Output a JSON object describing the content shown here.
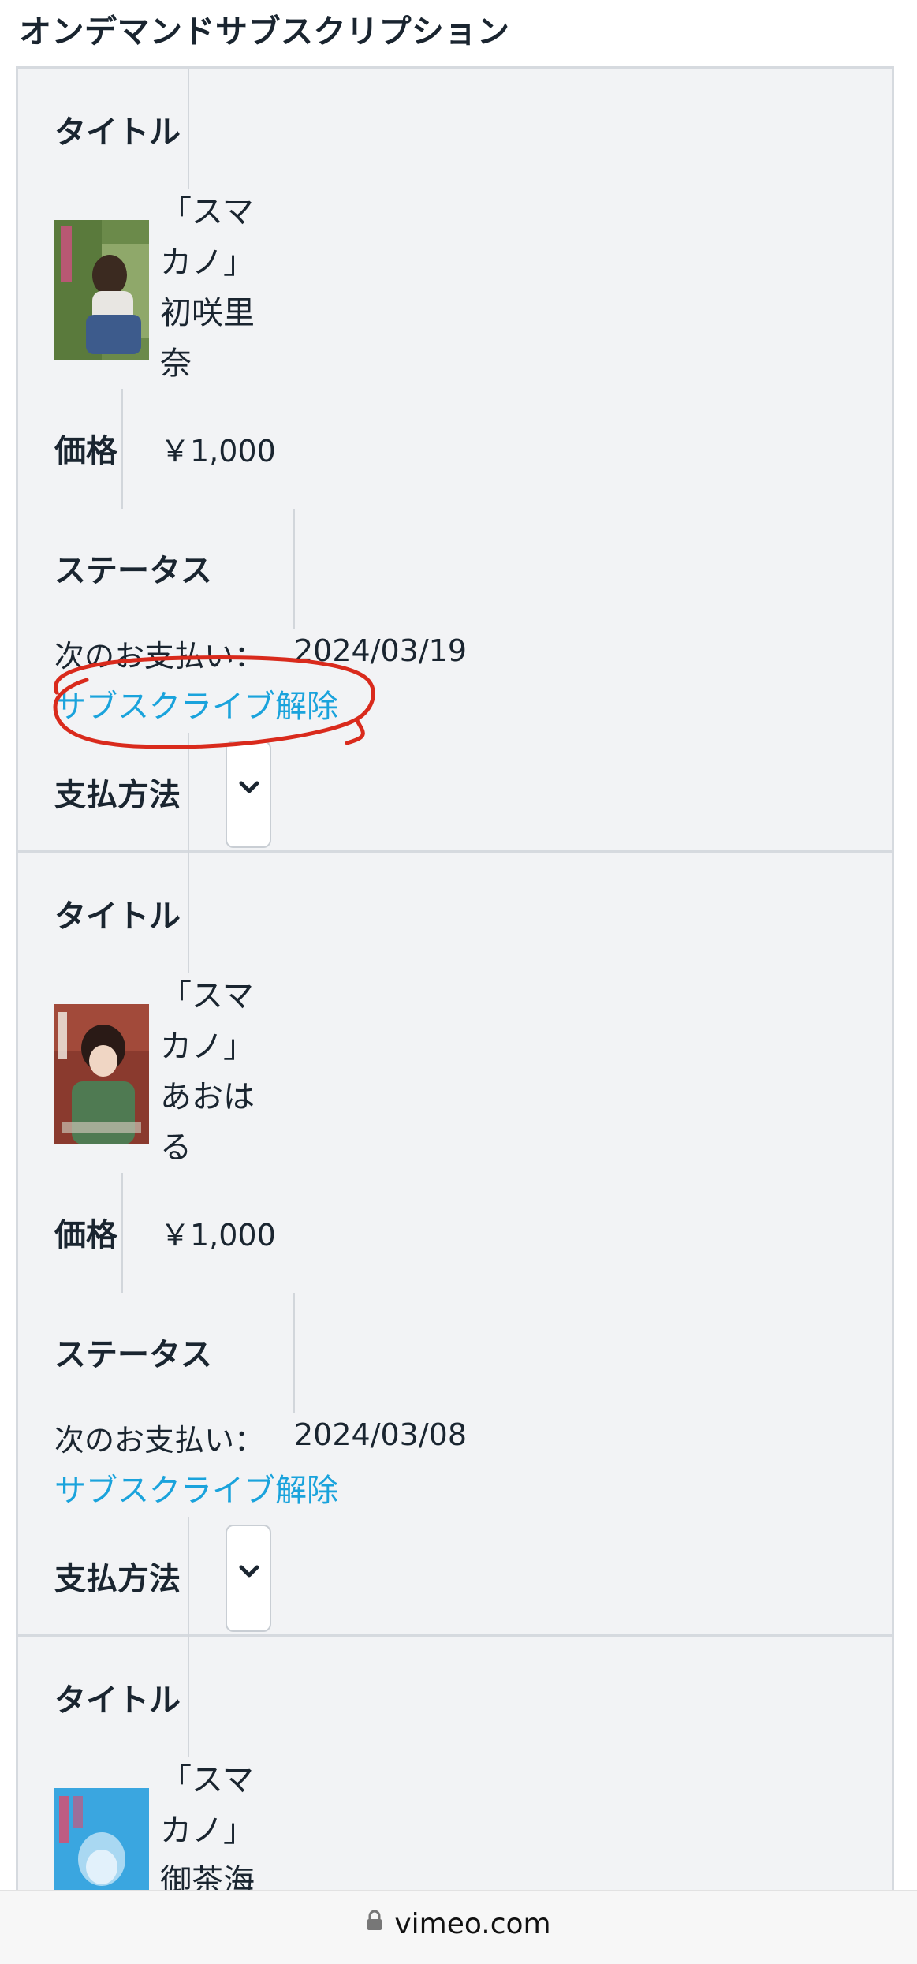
{
  "page": {
    "heading": "オンデマンドサブスクリプション"
  },
  "labels": {
    "title": "タイトル",
    "price": "価格",
    "status": "ステータス",
    "payment_method": "支払方法",
    "next_payment": "次のお支払い："
  },
  "subscriptions": [
    {
      "title": "「スマカノ」初咲里奈",
      "title_lines": "「スマ\nカノ」\n初咲里\n奈",
      "price": "￥1,000",
      "next_payment_date": "2024/03/19",
      "unsubscribe_label": "サブスクライブ解除",
      "thumb_icon": "poster-image",
      "thumb_colors": [
        "#6b8a4a",
        "#d9d6cf",
        "#3d5b8c"
      ]
    },
    {
      "title": "「スマカノ」あおはる",
      "title_lines": "「スマ\nカノ」\nあおは\nる",
      "price": "￥1,000",
      "next_payment_date": "2024/03/08",
      "unsubscribe_label": "サブスクライブ解除",
      "thumb_icon": "poster-image",
      "thumb_colors": [
        "#8a3a2e",
        "#4f7a52",
        "#c9c2b4"
      ]
    },
    {
      "title": "「スマカノ」御茶海",
      "title_lines": "「スマ\nカノ」\n御茶海",
      "thumb_icon": "poster-image",
      "thumb_colors": [
        "#3aa6e0",
        "#a9d8f2",
        "#e2f1fb"
      ]
    }
  ],
  "address_bar": {
    "domain": "vimeo.com",
    "icon": "lock-icon"
  },
  "annotation": {
    "color": "#d92a1c",
    "shape": "hand-drawn-circle"
  }
}
